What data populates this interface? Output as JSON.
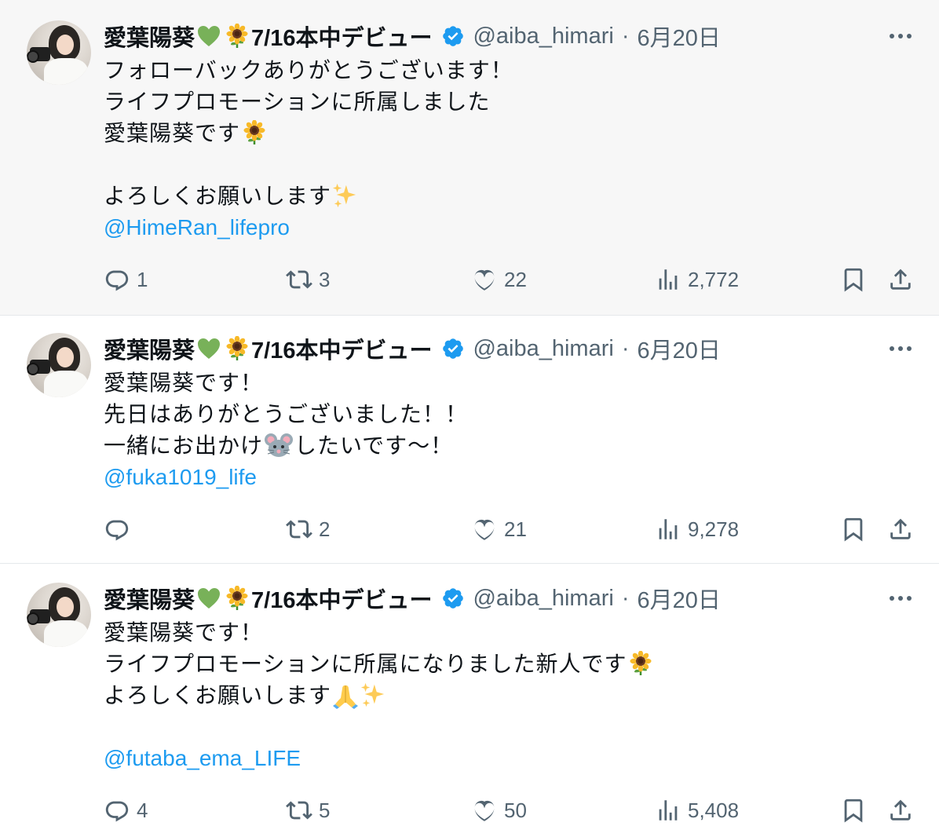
{
  "author": {
    "name": "愛葉陽葵",
    "name_suffix": "7/16本中デビュー",
    "handle": "@aiba_himari",
    "separator": "·"
  },
  "colors": {
    "link": "#1d9bf0",
    "verified": "#1d9bf0",
    "muted": "#536471",
    "highlight_bg": "#f7f7f7"
  },
  "tweets": [
    {
      "date": "6月20日",
      "lines": [
        "フォローバックありがとうございます！",
        "ライフプロモーションに所属しました",
        "愛葉陽葵です",
        "",
        "よろしくお願いします"
      ],
      "mention": "@HimeRan_lifepro",
      "reply_count": "1",
      "retweet_count": "3",
      "like_count": "22",
      "view_count": "2,772"
    },
    {
      "date": "6月20日",
      "lines": [
        "愛葉陽葵です！",
        "先日はありがとうございました！！",
        "一緒にお出かけ",
        "したいです〜！"
      ],
      "mention": "@fuka1019_life",
      "reply_count": "",
      "retweet_count": "2",
      "like_count": "21",
      "view_count": "9,278"
    },
    {
      "date": "6月20日",
      "lines": [
        "愛葉陽葵です！",
        "ライフプロモーションに所属になりました新人です",
        "よろしくお願いします",
        ""
      ],
      "mention": "@futaba_ema_LIFE",
      "reply_count": "4",
      "retweet_count": "5",
      "like_count": "50",
      "view_count": "5,408"
    }
  ],
  "icons": [
    "more-icon",
    "verified-badge-icon",
    "reply-icon",
    "retweet-icon",
    "like-icon",
    "views-icon",
    "bookmark-icon",
    "share-icon",
    "green-heart-emoji",
    "sunflower-emoji",
    "sparkles-emoji",
    "mouse-emoji",
    "folded-hands-emoji"
  ]
}
